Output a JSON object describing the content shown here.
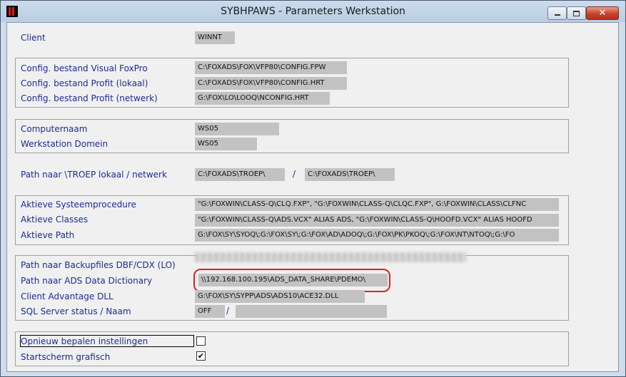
{
  "window": {
    "title": "SYBHPAWS - Parameters Werkstation",
    "minimize_label": "",
    "maximize_label": "",
    "close_label": "✕"
  },
  "client": {
    "label": "Client",
    "value": "WINNT"
  },
  "config": {
    "vfp_label": "Config. bestand Visual FoxPro",
    "vfp_value": "C:\\FOXADS\\FOX\\VFP80\\CONFIG.FPW",
    "profit_local_label": "Config. bestand Profit (lokaal)",
    "profit_local_value": "C:\\FOXADS\\FOX\\VFP80\\CONFIG.HRT",
    "profit_net_label": "Config. bestand Profit (netwerk)",
    "profit_net_value": "G:\\FOX\\LO\\LOOQ\\NCONFIG.HRT"
  },
  "computer": {
    "name_label": "Computernaam",
    "name_value": "WS05",
    "domain_label": "Werkstation Domein",
    "domain_value": "WS05"
  },
  "troep": {
    "label": "Path naar \\TROEP lokaal / netwerk",
    "local_value": "C:\\FOXADS\\TROEP\\",
    "separator": "/",
    "network_value": "C:\\FOXADS\\TROEP\\"
  },
  "active": {
    "proc_label": "Aktieve Systeemprocedure",
    "proc_value": "\"G:\\FOXWIN\\CLASS-Q\\CLQ.FXP\", \"G:\\FOXWIN\\CLASS-Q\\CLQC.FXP\", G:\\FOXWIN\\CLASS\\CLFNC",
    "classes_label": "Aktieve Classes",
    "classes_value": "\"G:\\FOXWIN\\CLASS-Q\\ADS.VCX\" ALIAS ADS, \"G:\\FOXWIN\\CLASS-Q\\HOOFD.VCX\" ALIAS HOOFD",
    "path_label": "Aktieve Path",
    "path_value": "G:\\FOX\\SY\\SYOQ\\;G:\\FOX\\SY\\;G:\\FOX\\AD\\ADOQ\\;G:\\FOX\\PK\\PKOQ\\;G:\\FOX\\NT\\NTOQ\\;G:\\FO"
  },
  "paths": {
    "backup_label": "Path naar Backupfiles DBF/CDX (LO)",
    "ads_dict_label": "Path naar ADS Data Dictionary",
    "ads_dict_value": "\\\\192.168.100.195\\ADS_DATA_SHARE\\PDEMO\\",
    "client_dll_label": "Client Advantage DLL",
    "client_dll_value": "G:\\FOX\\SY\\SYPP\\ADS\\ADS10\\ACE32.DLL",
    "sql_label": "SQL Server status / Naam",
    "sql_status_value": "OFF",
    "sql_separator": "/"
  },
  "options": {
    "redetermine_label": "Opnieuw bepalen instellingen",
    "redetermine_checked": false,
    "startscreen_label": "Startscherm grafisch",
    "startscreen_checked": true,
    "check_mark": "✔"
  },
  "colors": {
    "label_text": "#1c2c94",
    "field_bg": "#c2c2c2",
    "highlight": "#e02020"
  }
}
